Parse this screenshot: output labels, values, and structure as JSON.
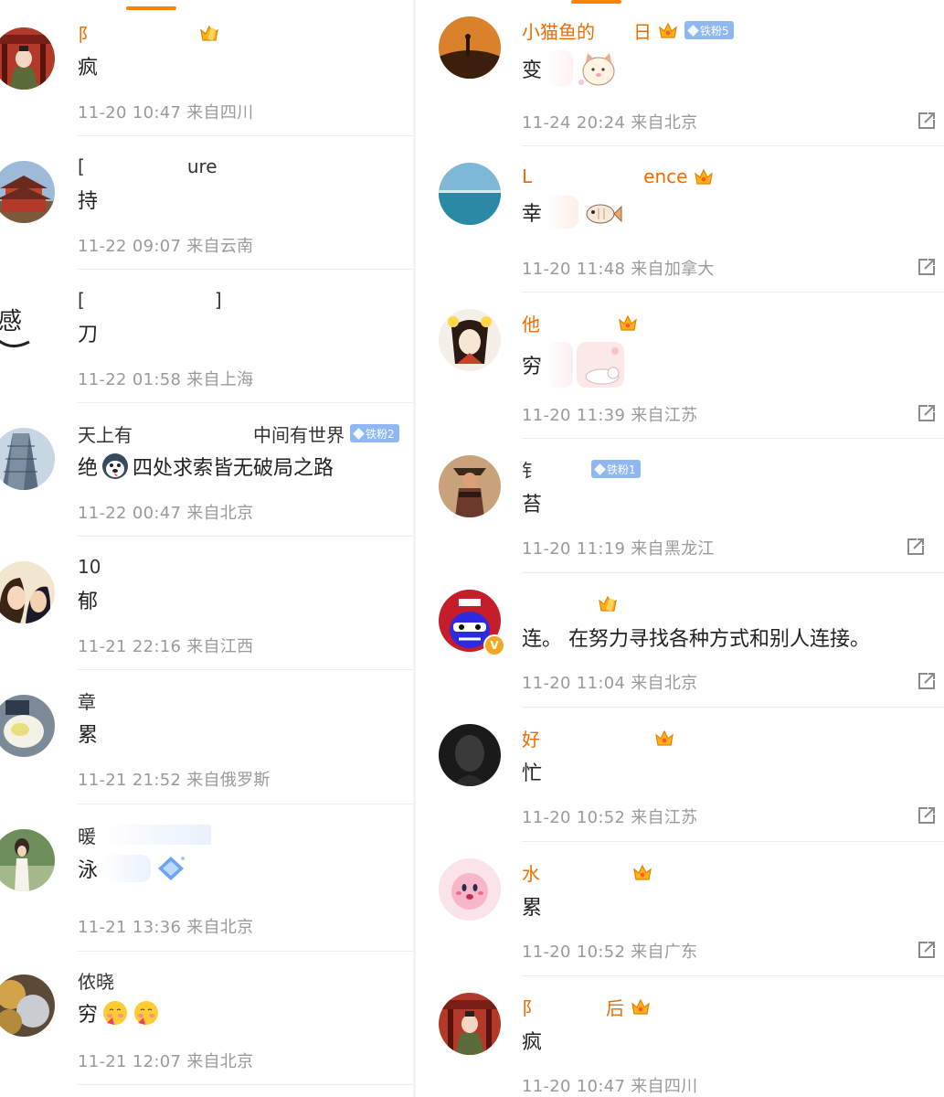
{
  "left": {
    "comments": [
      {
        "name": "阝",
        "name_vip": true,
        "text": "疯",
        "time": "11-20 10:47",
        "location": "来自四川",
        "badge": "crown"
      },
      {
        "name": "[",
        "name_tail": "ure",
        "name_vip": false,
        "text": "持",
        "time": "11-22 09:07",
        "location": "来自云南"
      },
      {
        "name": "[",
        "name_tail": "]",
        "name_vip": false,
        "text": "刀",
        "time": "11-22 01:58",
        "location": "来自上海"
      },
      {
        "name": "天上有",
        "name_tail": "中间有世界",
        "name_vip": false,
        "fan": "铁粉2",
        "text_a": "绝",
        "text_b": "四处求索皆无破局之路",
        "time": "11-22 00:47",
        "location": "来自北京"
      },
      {
        "name": "10",
        "name_vip": false,
        "text": "郁",
        "time": "11-21 22:16",
        "location": "来自江西"
      },
      {
        "name": "章",
        "name_vip": false,
        "text": "累",
        "time": "11-21 21:52",
        "location": "来自俄罗斯"
      },
      {
        "name": "暖",
        "name_vip": false,
        "text": "泳",
        "time": "11-21 13:36",
        "location": "来自北京"
      },
      {
        "name": "侬晓",
        "name_vip": false,
        "text": "穷",
        "time": "11-21 12:07",
        "location": "来自北京"
      }
    ]
  },
  "right": {
    "comments": [
      {
        "name": "小猫鱼的",
        "name_tail": "日",
        "name_vip": true,
        "fan": "铁粉5",
        "text": "变",
        "time": "11-24 20:24",
        "location": "来自北京"
      },
      {
        "name": "L",
        "name_tail": "ence",
        "name_vip": true,
        "text": "幸",
        "time": "11-20 11:48",
        "location": "来自加拿大"
      },
      {
        "name": "他",
        "name_vip": true,
        "text": "穷",
        "time": "11-20 11:39",
        "location": "来自江苏"
      },
      {
        "name": "钅",
        "name_vip": false,
        "fan": "铁粉1",
        "text": "苔",
        "time": "11-20 11:19",
        "location": "来自黑龙江"
      },
      {
        "name": "",
        "name_vip": true,
        "text": "连。 在努力寻找各种方式和别人连接。",
        "time": "11-20 11:04",
        "location": "来自北京",
        "verified": true
      },
      {
        "name": "好",
        "name_vip": true,
        "text": "忙",
        "time": "11-20 10:52",
        "location": "来自江苏"
      },
      {
        "name": "水",
        "name_vip": true,
        "text": "累",
        "time": "11-20 10:52",
        "location": "来自广东"
      },
      {
        "name": "阝",
        "name_tail": "后",
        "name_vip": true,
        "text": "疯",
        "time": "11-20 10:47",
        "location": "来自四川"
      }
    ]
  },
  "colors": {
    "accent": "#ff8200",
    "vip_name": "#f06c00",
    "meta": "#9a9a9a",
    "fan_badge": "#8fb7f4"
  }
}
